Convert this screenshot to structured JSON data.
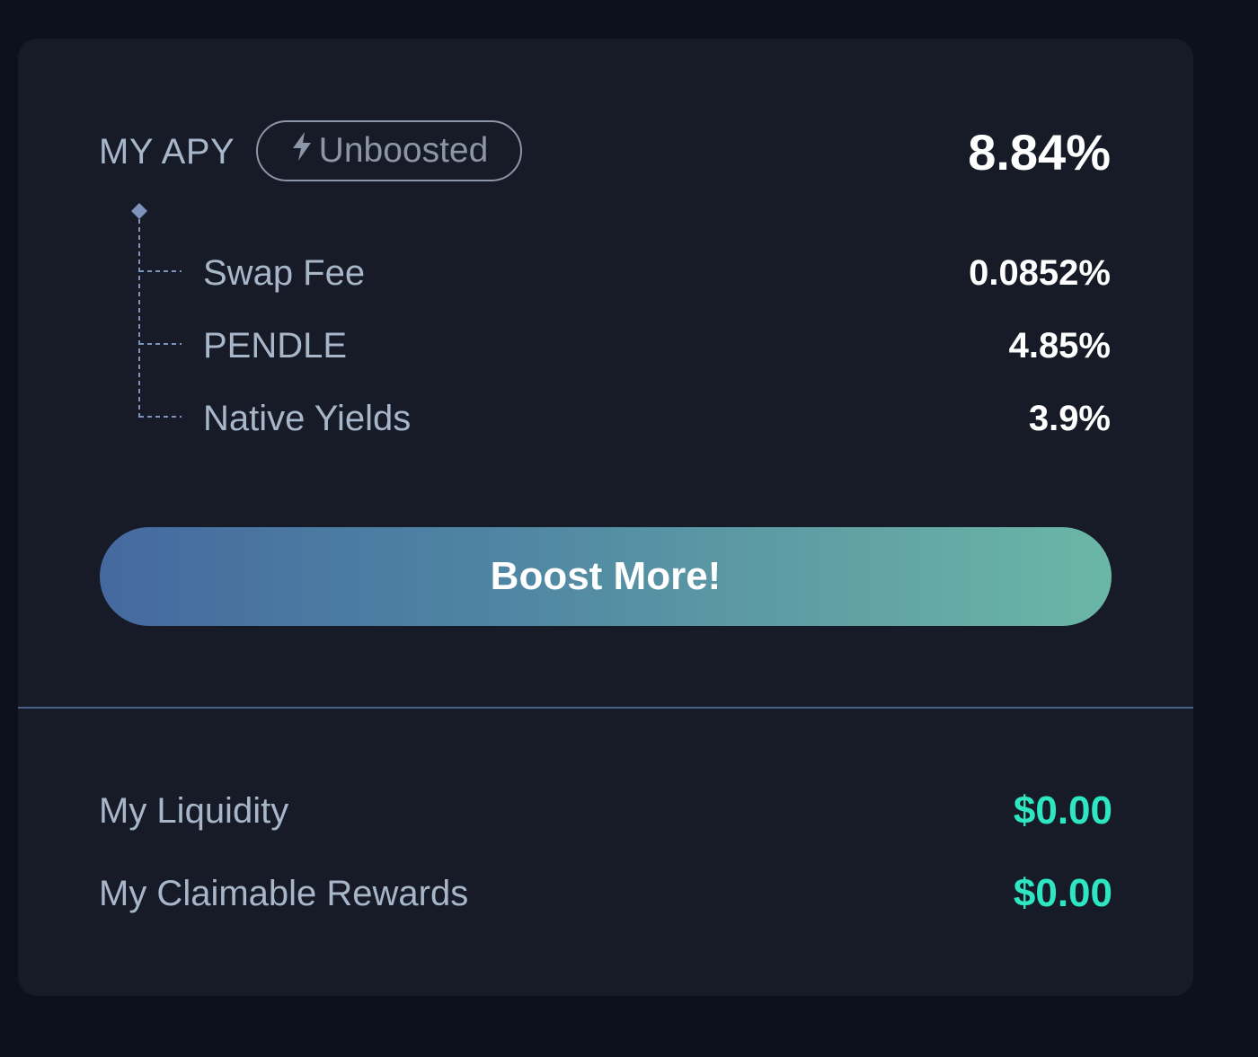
{
  "apy": {
    "label": "MY APY",
    "badge_label": "Unboosted",
    "badge_icon": "lightning-icon",
    "value": "8.84%"
  },
  "breakdown": [
    {
      "label": "Swap Fee",
      "value": "0.0852%"
    },
    {
      "label": "PENDLE",
      "value": "4.85%"
    },
    {
      "label": "Native Yields",
      "value": "3.9%"
    }
  ],
  "boost_button": {
    "label": "Boost More!"
  },
  "stats": [
    {
      "label": "My Liquidity",
      "value": "$0.00"
    },
    {
      "label": "My Claimable Rewards",
      "value": "$0.00"
    }
  ],
  "colors": {
    "background": "#0d111d",
    "card": "#161b27",
    "label_text": "#a8b6c9",
    "accent_green": "#2ee6c1",
    "button_gradient_start": "#45699f",
    "button_gradient_end": "#6bb7a6"
  }
}
